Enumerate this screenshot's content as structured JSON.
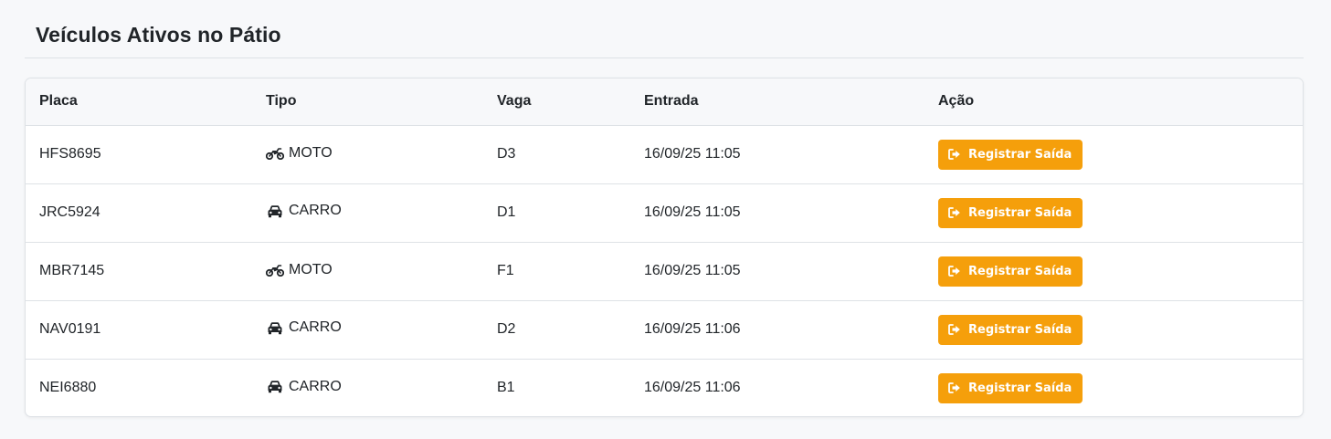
{
  "page": {
    "title": "Veículos Ativos no Pátio"
  },
  "table": {
    "headers": {
      "placa": "Placa",
      "tipo": "Tipo",
      "vaga": "Vaga",
      "entrada": "Entrada",
      "acao": "Ação"
    },
    "rows": [
      {
        "placa": "HFS8695",
        "tipo": "MOTO",
        "tipo_icon": "motorcycle-icon",
        "vaga": "D3",
        "entrada": "16/09/25 11:05",
        "action_label": "Registrar Saída"
      },
      {
        "placa": "JRC5924",
        "tipo": "CARRO",
        "tipo_icon": "car-icon",
        "vaga": "D1",
        "entrada": "16/09/25 11:05",
        "action_label": "Registrar Saída"
      },
      {
        "placa": "MBR7145",
        "tipo": "MOTO",
        "tipo_icon": "motorcycle-icon",
        "vaga": "F1",
        "entrada": "16/09/25 11:05",
        "action_label": "Registrar Saída"
      },
      {
        "placa": "NAV0191",
        "tipo": "CARRO",
        "tipo_icon": "car-icon",
        "vaga": "D2",
        "entrada": "16/09/25 11:06",
        "action_label": "Registrar Saída"
      },
      {
        "placa": "NEI6880",
        "tipo": "CARRO",
        "tipo_icon": "car-icon",
        "vaga": "B1",
        "entrada": "16/09/25 11:06",
        "action_label": "Registrar Saída"
      }
    ]
  },
  "icons": {
    "action": "sign-out-icon"
  },
  "colors": {
    "action_button": "#f59f0b",
    "background": "#f7f8fa",
    "text": "#212529"
  }
}
